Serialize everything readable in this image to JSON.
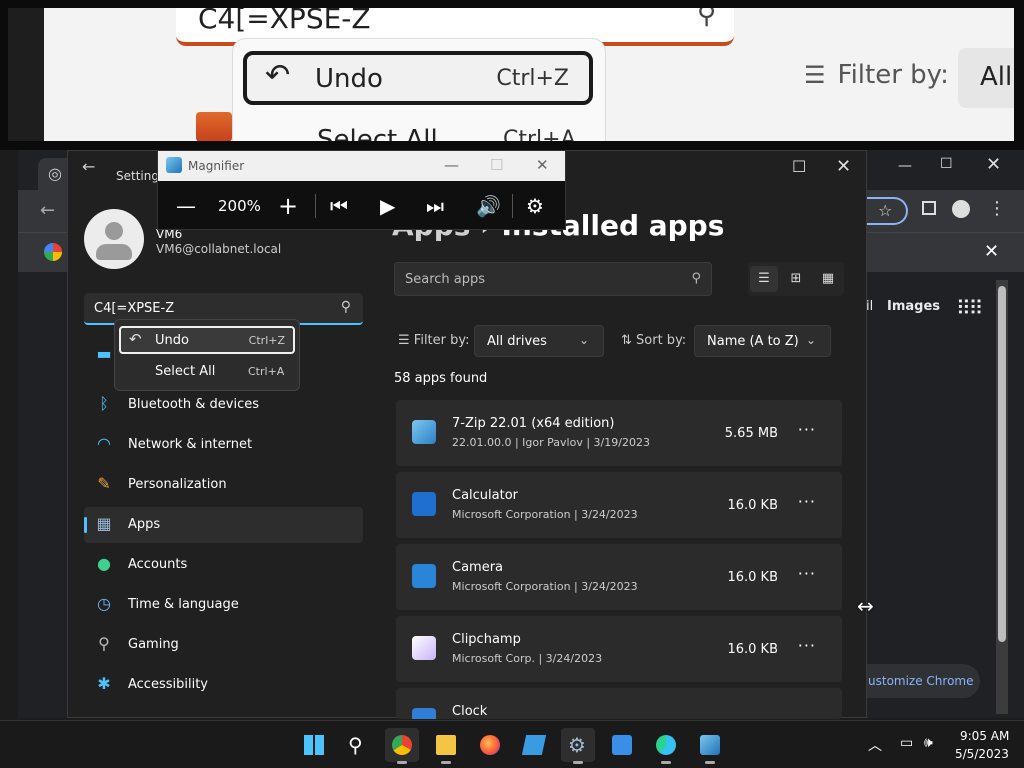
{
  "zoom_view": {
    "search_value": "C4[=XPSE-Z",
    "undo_label": "Undo",
    "undo_shortcut": "Ctrl+Z",
    "select_all_label": "Select All",
    "select_all_shortcut": "Ctrl+A",
    "filter_label": "Filter by:",
    "filter_value": "All"
  },
  "magnifier": {
    "title": "Magnifier",
    "zoom_level": "200%"
  },
  "settings": {
    "title": "Settings",
    "user": {
      "name": "VM6",
      "email": "VM6@collabnet.local"
    },
    "search_value": "C4[=XPSE-Z",
    "context_menu": {
      "undo_label": "Undo",
      "undo_shortcut": "Ctrl+Z",
      "select_all_label": "Select All",
      "select_all_shortcut": "Ctrl+A"
    },
    "nav": [
      {
        "label": "Bluetooth & devices",
        "icon": "bluetooth-icon"
      },
      {
        "label": "Network & internet",
        "icon": "wifi-icon"
      },
      {
        "label": "Personalization",
        "icon": "brush-icon"
      },
      {
        "label": "Apps",
        "icon": "apps-icon"
      },
      {
        "label": "Accounts",
        "icon": "person-icon"
      },
      {
        "label": "Time & language",
        "icon": "clock-globe-icon"
      },
      {
        "label": "Gaming",
        "icon": "gamepad-icon"
      },
      {
        "label": "Accessibility",
        "icon": "accessibility-icon"
      }
    ],
    "heading": {
      "parent": "Apps",
      "separator": "›",
      "current": "Installed apps"
    },
    "app_search_placeholder": "Search apps",
    "filter_label": "Filter by:",
    "filter_value": "All drives",
    "sort_label": "Sort by:",
    "sort_value": "Name (A to Z)",
    "apps_found": "58 apps found",
    "apps": [
      {
        "name": "7-Zip 22.01 (x64 edition)",
        "meta": "22.01.00.0  |  Igor Pavlov  |  3/19/2023",
        "size": "5.65 MB",
        "icon": "7zip-icon"
      },
      {
        "name": "Calculator",
        "meta": "Microsoft Corporation  |  3/24/2023",
        "size": "16.0 KB",
        "icon": "calculator-icon"
      },
      {
        "name": "Camera",
        "meta": "Microsoft Corporation  |  3/24/2023",
        "size": "16.0 KB",
        "icon": "camera-icon"
      },
      {
        "name": "Clipchamp",
        "meta": "Microsoft Corp.  |  3/24/2023",
        "size": "16.0 KB",
        "icon": "clipchamp-icon"
      },
      {
        "name": "Clock",
        "meta": "",
        "size": "",
        "icon": "clock-icon"
      }
    ]
  },
  "chrome": {
    "links_label": "il",
    "images_label": "Images",
    "customize_label": "ustomize Chrome"
  },
  "taskbar": {
    "time": "9:05 AM",
    "date": "5/5/2023"
  },
  "colors": {
    "accent": "#4cc2ff",
    "settings_bg": "#202020",
    "card_bg": "#2b2b2b"
  }
}
